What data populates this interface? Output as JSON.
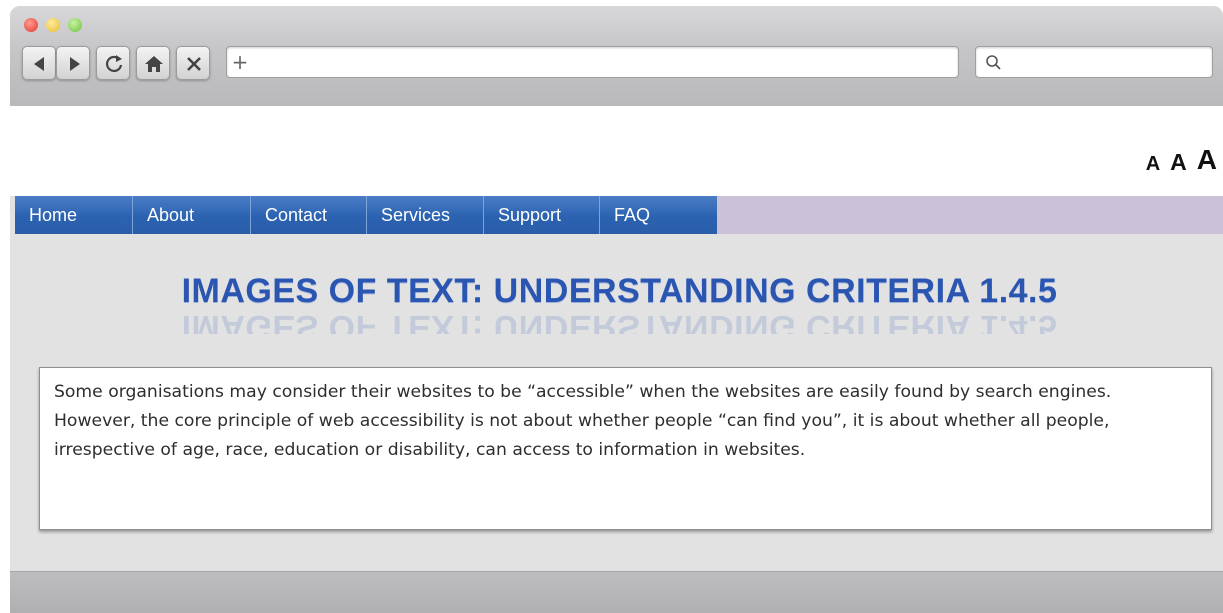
{
  "toolbar": {
    "address_plus": "+",
    "address_value": "",
    "search_value": ""
  },
  "icons": {
    "back": "back-arrow-icon",
    "forward": "forward-arrow-icon",
    "refresh": "refresh-icon",
    "home": "home-icon",
    "stop": "close-icon",
    "search": "search-icon"
  },
  "text_size": {
    "small": "A",
    "medium": "A",
    "large": "A"
  },
  "nav": {
    "items": [
      {
        "label": "Home"
      },
      {
        "label": "About"
      },
      {
        "label": "Contact"
      },
      {
        "label": "Services"
      },
      {
        "label": "Support"
      },
      {
        "label": "FAQ"
      }
    ]
  },
  "main": {
    "heading": "IMAGES OF TEXT: UNDERSTANDING CRITERIA 1.4.5",
    "body": "Some organisations may consider their websites to be “accessible” when the websites are easily found by search engines. However, the core principle of web accessibility is not about whether people “can find you”, it is about whether all people, irrespective of age, race, education or disability, can access to information in websites."
  },
  "colors": {
    "nav_blue": "#2b62b0",
    "nav_filler": "#cbc2da",
    "heading_blue": "#2a55b0"
  }
}
